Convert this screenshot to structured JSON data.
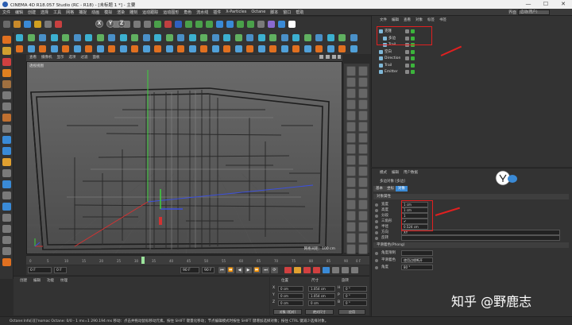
{
  "window": {
    "title": "CINEMA 4D R18.057 Studio (RC - R18) - [未标题 1 *] - 主要",
    "minimize": "—",
    "maximize": "☐",
    "close": "✕"
  },
  "menubar": {
    "items": [
      "文件",
      "编辑",
      "创建",
      "选择",
      "工具",
      "网格",
      "捕捉",
      "动画",
      "模拟",
      "渲染",
      "雕刻",
      "运动跟踪",
      "运动图形",
      "角色",
      "流水线",
      "插件",
      "X-Particles",
      "Octane",
      "脚本",
      "窗口",
      "帮助"
    ],
    "layout_label": "界面",
    "layout_value": "启动(用户)"
  },
  "viewport": {
    "menu": [
      "查看",
      "摄像机",
      "显示",
      "选项",
      "过滤",
      "面板"
    ],
    "label": "透视视图",
    "grid_info": "网格间距：100 cm"
  },
  "timeline": {
    "ticks": [
      "0",
      "5",
      "10",
      "15",
      "20",
      "25",
      "30",
      "35",
      "40",
      "45",
      "50",
      "55",
      "60",
      "65",
      "70",
      "75",
      "80",
      "85",
      "90"
    ],
    "end_label": "0 F",
    "start_field": "0 F",
    "current_field": "0 F",
    "end_field": "90 F",
    "max_field": "90 F",
    "buttons": [
      "⏮",
      "⏪",
      "◀",
      "▶",
      "⏩",
      "⏭",
      "⟳"
    ]
  },
  "materials": {
    "menu": [
      "创建",
      "编辑",
      "功能",
      "纹理"
    ]
  },
  "coordinates": {
    "head_position": "位置",
    "head_size": "尺寸",
    "head_rotation": "旋转",
    "rows": [
      {
        "axis": "X",
        "pos": "0 cm",
        "size": "1.054 cm",
        "rot_label": "H",
        "rot": "0 °"
      },
      {
        "axis": "Y",
        "pos": "0 cm",
        "size": "1.054 cm",
        "rot_label": "P",
        "rot": "0 °"
      },
      {
        "axis": "Z",
        "pos": "0 cm",
        "size": "0 cm",
        "rot_label": "B",
        "rot": "0 °"
      }
    ],
    "mode_button": "对象 (相对)",
    "size_button": "绝对尺寸",
    "apply_button": "应用"
  },
  "status": {
    "text": "Octane:Info[i][]'nomac Octane: 0/0 - 1 ms=1 290.194 ms 移动：点击并拖动鼠标移动元素。按住 SHIFT 键量化移动；节点编辑模式时按住 SHIFT 键增加选择对象；按住 CTRL 键减少选择对象。"
  },
  "object_manager": {
    "menu": [
      "文件",
      "编辑",
      "查看",
      "对象",
      "标签",
      "书签"
    ],
    "objects": [
      {
        "name": "克隆",
        "indent": 0
      },
      {
        "name": "多边",
        "indent": 1
      },
      {
        "name": "Trail",
        "indent": 1
      },
      {
        "name": "空白",
        "indent": 0
      },
      {
        "name": "Direction",
        "indent": 0
      },
      {
        "name": "Trail",
        "indent": 0
      },
      {
        "name": "Emitter",
        "indent": 0
      }
    ]
  },
  "attributes": {
    "menu": [
      "模式",
      "编辑",
      "用户数据"
    ],
    "object_title": "多边对象 [多边]",
    "tabs": [
      "基本",
      "坐标",
      "对象"
    ],
    "section_object": "对象属性",
    "fields": [
      {
        "label": "宽度",
        "value": "1 cm"
      },
      {
        "label": "高度",
        "value": "1 cm"
      },
      {
        "label": "分段",
        "value": "1"
      },
      {
        "label": "三角形",
        "value": "✔"
      },
      {
        "label": "半径",
        "value": "0.524 cm"
      },
      {
        "label": "方向",
        "value": "XY"
      },
      {
        "label": "反转",
        "value": ""
      }
    ],
    "section_phong": "平滑着色(Phong)",
    "phong_fields": [
      {
        "label": "角度限制",
        "value": ""
      },
      {
        "label": "平滑着色",
        "value": "使用边缘断开"
      },
      {
        "label": "角度",
        "value": "80 °"
      }
    ]
  },
  "watermark": {
    "text": "知乎 @野鹿志"
  },
  "colors": {
    "annotation_red": "#e02020",
    "axis_green": "#3cd23c",
    "axis_red": "#d23232",
    "axis_blue": "#3c50dc"
  }
}
